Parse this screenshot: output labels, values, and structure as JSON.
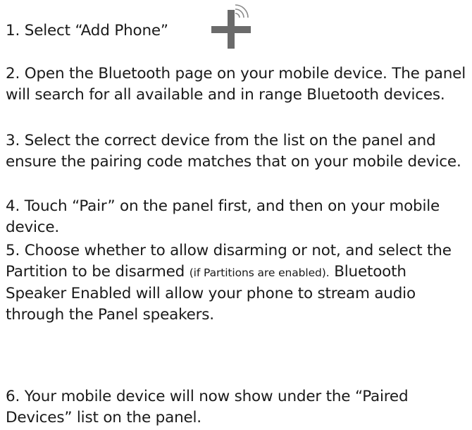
{
  "steps": [
    {
      "text": "1. Select “Add Phone”"
    },
    {
      "text": "2. Open the Bluetooth page on your mobile device.  The panel will search for all available and in range Bluetooth devices."
    },
    {
      "text": "3. Select the correct device from the list on the panel and ensure the pairing code matches that on your mobile device."
    },
    {
      "text": "4. Touch “Pair” on the panel first, and then on your mobile device."
    },
    {
      "text_a": "5. Choose whether to allow disarming or not, and select the Partition to be disarmed ",
      "text_small": "(if Partitions are enabled).",
      "text_b": " Bluetooth Speaker Enabled will allow your phone to stream audio through the Panel speakers."
    },
    {
      "text": "6.  Your mobile device will now show under the “Paired Devices” list on the panel."
    }
  ],
  "icons": {
    "add_phone": "add-phone-plus-signal-icon"
  },
  "colors": {
    "text": "#1a1a1a",
    "icon": "#6b6b6b",
    "background": "#ffffff"
  }
}
